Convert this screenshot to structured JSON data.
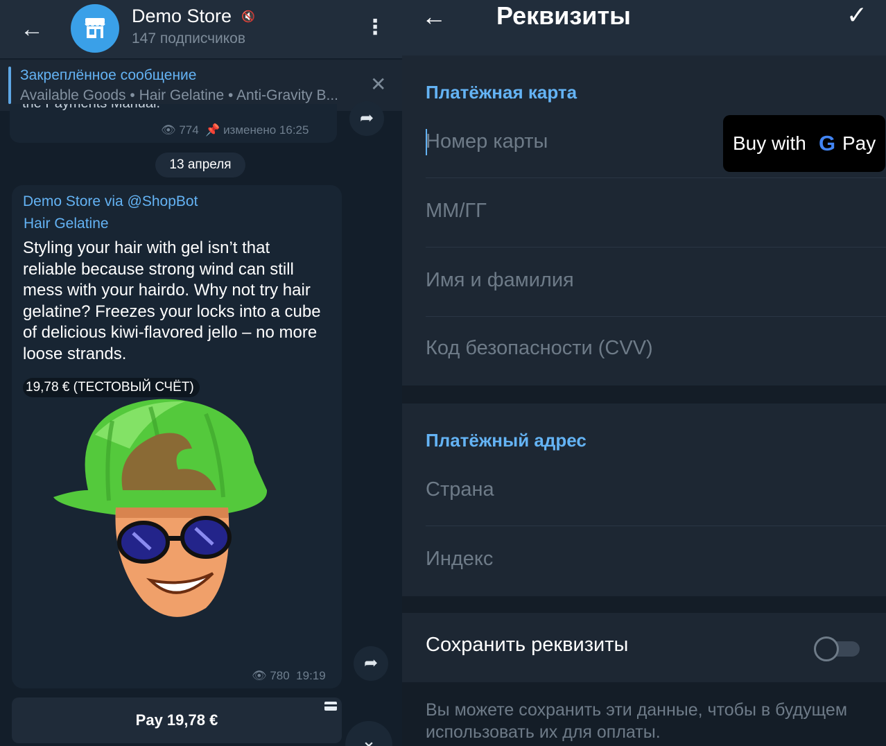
{
  "chat": {
    "channel_name": "Demo Store",
    "subscribers": "147 подписчиков",
    "pinned": {
      "title": "Закреплённое сообщение",
      "text": "Available Goods • Hair Gelatine • Anti-Gravity B..."
    },
    "previous_message": {
      "text_fragment": "the Payments Manual.",
      "views": "774",
      "edited": "изменено 16:25"
    },
    "date_separator": "13 апреля",
    "product_message": {
      "sender": "Demo Store via @ShopBot",
      "title": "Hair Gelatine",
      "description": "Styling your hair with gel isn’t that reliable because strong wind can still mess with your hairdo. Why not try hair gelatine? Freezes your locks into a cube of delicious kiwi-flavored jello – no more loose strands.",
      "price": "19,78 € (ТЕСТОВЫЙ СЧЁТ)",
      "views": "780",
      "time": "19:19"
    },
    "pay_button": "Pay 19,78 €"
  },
  "form": {
    "title": "Реквизиты",
    "card_section_title": "Платёжная карта",
    "fields_card": [
      {
        "placeholder": "Номер карты"
      },
      {
        "placeholder": "ММ/ГГ"
      },
      {
        "placeholder": "Имя и фамилия"
      },
      {
        "placeholder": "Код безопасности (CVV)"
      }
    ],
    "gpay": {
      "buy": "Buy with",
      "g": "G",
      "pay": "Pay"
    },
    "address_section_title": "Платёжный адрес",
    "fields_address": [
      {
        "placeholder": "Страна"
      },
      {
        "placeholder": "Индекс"
      }
    ],
    "save_label": "Сохранить реквизиты",
    "save_enabled": false,
    "save_hint": "Вы можете сохранить эти данные, чтобы в будущем использовать их для оплаты."
  },
  "colors": {
    "accent": "#64b3f4",
    "header_bg": "#212d3b",
    "chat_bg": "#0e1621",
    "bubble_bg": "#182533",
    "form_section_bg": "#1d2733",
    "placeholder": "#6e7b88"
  },
  "icons": [
    "back-arrow-icon",
    "store-icon",
    "mute-icon",
    "more-vertical-icon",
    "close-icon",
    "eye-icon",
    "pin-icon",
    "share-icon",
    "card-icon",
    "chevron-down-icon",
    "check-icon"
  ]
}
